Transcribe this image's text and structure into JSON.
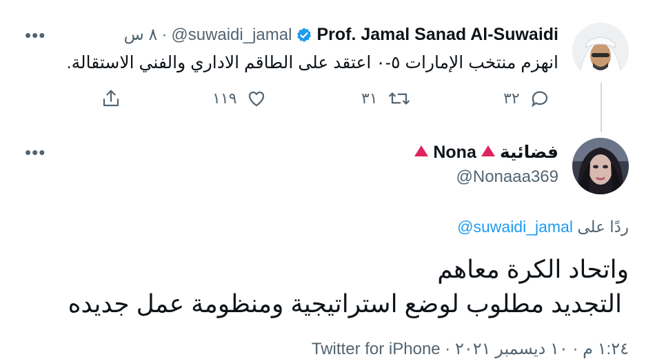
{
  "tweet1": {
    "author_name": "Prof. Jamal Sanad Al-Suwaidi",
    "author_handle": "@suwaidi_jamal",
    "time": "٨ س",
    "separator": "·",
    "text": "انهزم منتخب الإمارات ٥-٠ اعتقد على الطاقم الاداري والفني الاستقالة.",
    "replies": "٣٢",
    "retweets": "٣١",
    "likes": "١١٩"
  },
  "tweet2": {
    "author_name": "فضائية",
    "author_name_2": "Nona",
    "author_handle": "@Nonaaa369",
    "reply_prefix": "ردًا على",
    "reply_to": "@suwaidi_jamal",
    "text_line1": "واتحاد الكرة معاهم",
    "text_line2": "التجديد مطلوب لوضع استراتيجية ومنظومة عمل جديده",
    "meta": "١:٢٤ م · ١٠ ديسمبر ٢٠٢١ · Twitter for iPhone"
  },
  "colors": {
    "verified": "#1d9bf0",
    "triangle": "#e0245e",
    "muted": "#536471"
  }
}
